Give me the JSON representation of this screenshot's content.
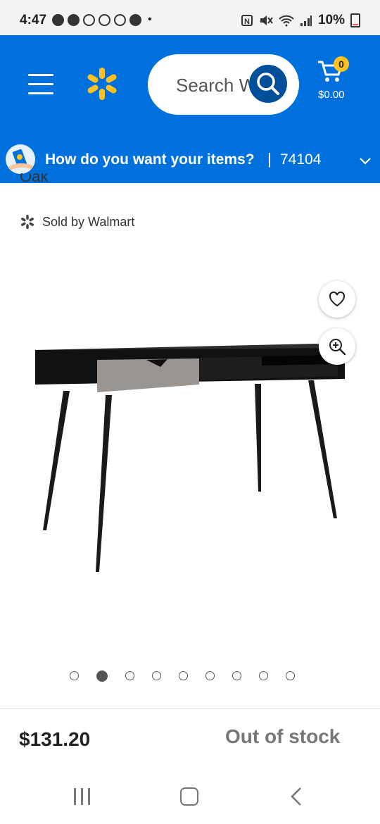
{
  "status_bar": {
    "time": "4:47",
    "battery": "10%",
    "left_icons": [
      "messenger-icon",
      "notification-icon",
      "tiktok-icon",
      "tiktok-icon",
      "tiktok-icon",
      "pinterest-icon"
    ],
    "right_icons": [
      "nfc-icon",
      "mute-icon",
      "wifi-icon",
      "signal-icon",
      "battery-icon"
    ]
  },
  "header": {
    "search_placeholder": "Search W",
    "cart_count": "0",
    "cart_total": "$0.00",
    "brand_color": "#0071dc",
    "spark_color": "#ffc220"
  },
  "delivery": {
    "question": "How do you want your items?",
    "separator": "|",
    "zip": "74104"
  },
  "product": {
    "title_fragment": "Oak",
    "seller": "Sold by Walmart",
    "image_count": 9,
    "active_image_index": 1,
    "price": "$131.20",
    "availability": "Out of stock"
  }
}
